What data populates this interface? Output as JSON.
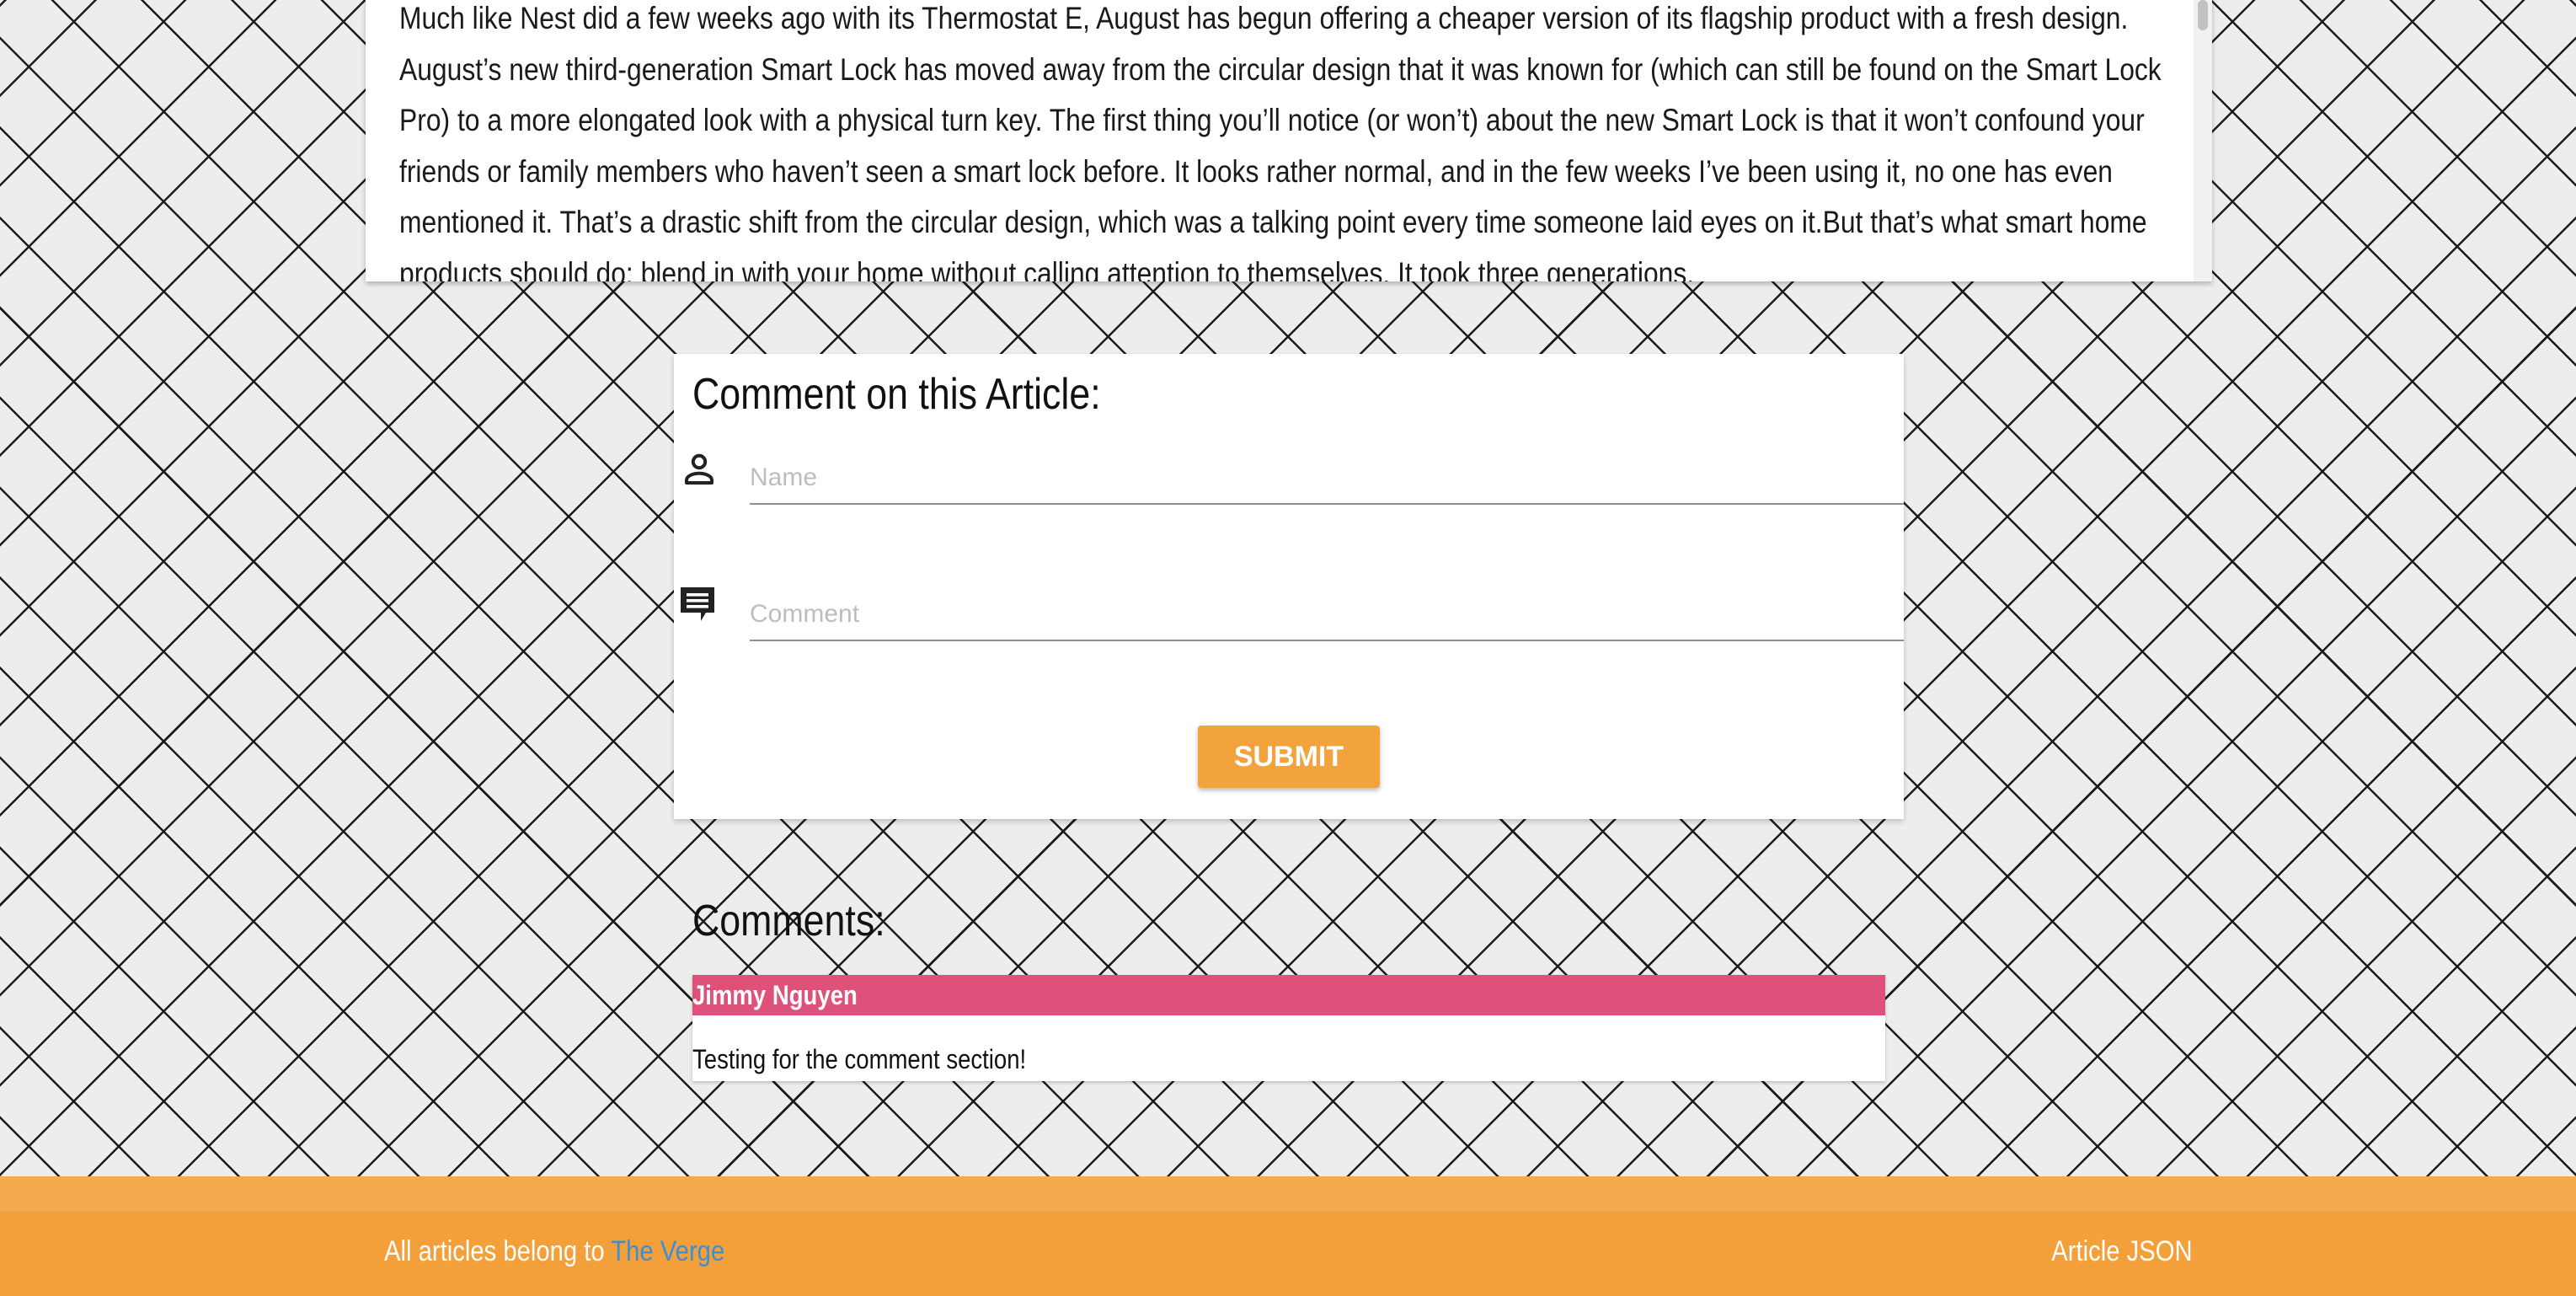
{
  "article": {
    "paragraph": "Much like Nest did a few weeks ago with its Thermostat E, August has begun offering a cheaper version of its flagship product with a fresh design. August’s new third-generation Smart Lock has moved away from the circular design that it was known for (which can still be found on the Smart Lock Pro) to a more elongated look with a physical turn key. The first thing you’ll notice (or won’t) about the new Smart Lock is that it won’t confound your friends or family members who haven’t seen a smart lock before. It looks rather normal, and in the few weeks I’ve been using it, no one has even mentioned it. That’s a drastic shift from the circular design, which was a talking point every time someone laid eyes on it.But that’s what smart home products should do: blend in with your home without calling attention to themselves. It took three generations,"
  },
  "comment_form": {
    "title": "Comment on this Article:",
    "name_placeholder": "Name",
    "comment_placeholder": "Comment",
    "submit_label": "SUBMIT",
    "name_icon": "person-icon",
    "comment_icon": "comment-icon"
  },
  "comments": {
    "title": "Comments:",
    "items": [
      {
        "author": "Jimmy Nguyen",
        "text": "Testing for the comment section!"
      }
    ]
  },
  "footer": {
    "credit_prefix": "All articles belong to",
    "credit_link": "The Verge",
    "json_link": "Article JSON"
  },
  "colors": {
    "accent_orange": "#f3a33b",
    "author_bar_pink": "#de517a",
    "link_blue": "#3d8fd3",
    "background": "#eeedee"
  }
}
